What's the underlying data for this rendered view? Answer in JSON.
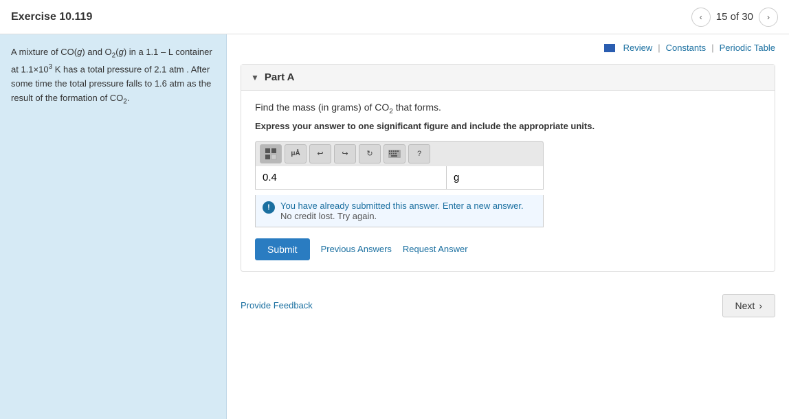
{
  "header": {
    "title": "Exercise 10.119",
    "nav_count": "15 of 30",
    "prev_label": "‹",
    "next_label": "›"
  },
  "top_links": {
    "review_label": "Review",
    "constants_label": "Constants",
    "periodic_table_label": "Periodic Table"
  },
  "part": {
    "label": "Part A",
    "question": "Find the mass (in grams) of CO₂ that forms.",
    "instruction": "Express your answer to one significant figure and include the appropriate units.",
    "toolbar": {
      "btn1": "⊞",
      "btn2": "μÅ",
      "btn3": "↺",
      "btn4": "↻",
      "btn5": "↻",
      "btn6": "⌨",
      "btn7": "?"
    },
    "answer_value": "0.4",
    "unit_value": "g",
    "info_message_line1": "You have already submitted this answer. Enter a new answer.",
    "info_message_line2": "No credit lost. Try again.",
    "submit_label": "Submit",
    "previous_answers_label": "Previous Answers",
    "request_answer_label": "Request Answer"
  },
  "footer": {
    "feedback_label": "Provide Feedback",
    "next_label": "Next"
  },
  "sidebar": {
    "text_parts": {
      "intro": "A mixture of CO(g) and O₂(g) in a 1.1 – L container at 1.1×10³ K has a total pressure of 2.1 atm. After some time the total pressure falls to 1.6 atm as the result of the formation of CO₂."
    }
  }
}
